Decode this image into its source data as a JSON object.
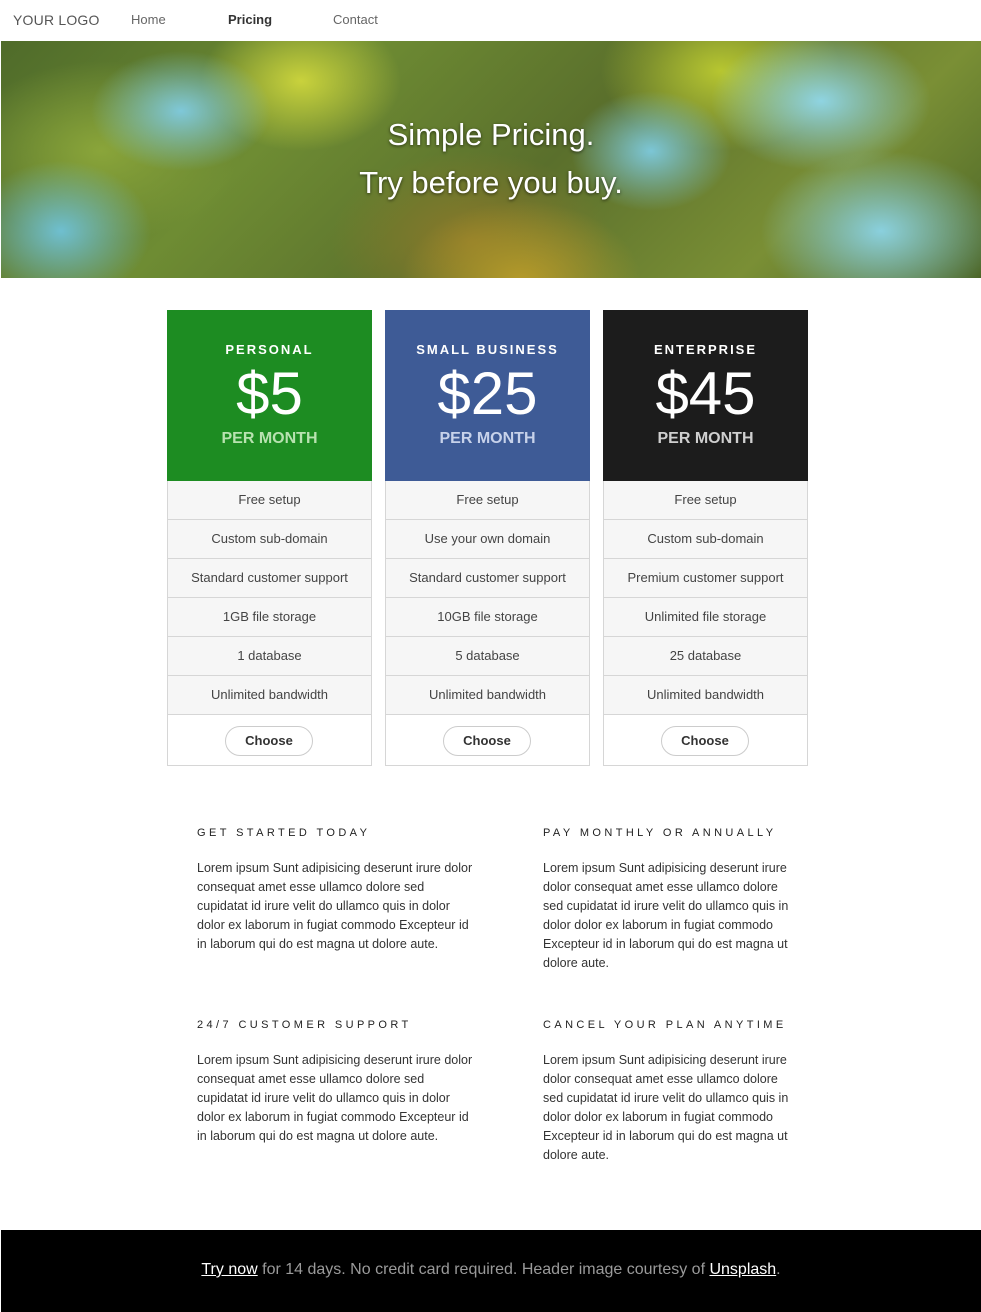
{
  "nav": {
    "logo": "YOUR LOGO",
    "items": [
      {
        "label": "Home",
        "active": false
      },
      {
        "label": "Pricing",
        "active": true
      },
      {
        "label": "Contact",
        "active": false
      }
    ]
  },
  "hero": {
    "line1": "Simple Pricing.",
    "line2": "Try before you buy."
  },
  "plans": [
    {
      "name": "PERSONAL",
      "price": "$5",
      "period": "PER MONTH",
      "color": "#1d8c22",
      "features": [
        "Free setup",
        "Custom sub-domain",
        "Standard customer support",
        "1GB file storage",
        "1 database",
        "Unlimited bandwidth"
      ],
      "button": "Choose"
    },
    {
      "name": "SMALL BUSINESS",
      "price": "$25",
      "period": "PER MONTH",
      "color": "#3e5b96",
      "features": [
        "Free setup",
        "Use your own domain",
        "Standard customer support",
        "10GB file storage",
        "5 database",
        "Unlimited bandwidth"
      ],
      "button": "Choose"
    },
    {
      "name": "ENTERPRISE",
      "price": "$45",
      "period": "PER MONTH",
      "color": "#1c1c1c",
      "features": [
        "Free setup",
        "Custom sub-domain",
        "Premium customer support",
        "Unlimited file storage",
        "25 database",
        "Unlimited bandwidth"
      ],
      "button": "Choose"
    }
  ],
  "features": [
    {
      "title": "GET STARTED TODAY",
      "text": "Lorem ipsum Sunt adipisicing deserunt irure dolor consequat amet esse ullamco dolore sed cupidatat id irure velit do ullamco quis in dolor dolor ex laborum in fugiat commodo Excepteur id in laborum qui do est magna ut dolore aute."
    },
    {
      "title": "PAY MONTHLY OR ANNUALLY",
      "text": "Lorem ipsum Sunt adipisicing deserunt irure dolor consequat amet esse ullamco dolore sed cupidatat id irure velit do ullamco quis in dolor dolor ex laborum in fugiat commodo Excepteur id in laborum qui do est magna ut dolore aute."
    },
    {
      "title": "24/7 CUSTOMER SUPPORT",
      "text": "Lorem ipsum Sunt adipisicing deserunt irure dolor consequat amet esse ullamco dolore sed cupidatat id irure velit do ullamco quis in dolor dolor ex laborum in fugiat commodo Excepteur id in laborum qui do est magna ut dolore aute."
    },
    {
      "title": "CANCEL YOUR PLAN ANYTIME",
      "text": "Lorem ipsum Sunt adipisicing deserunt irure dolor consequat amet esse ullamco dolore sed cupidatat id irure velit do ullamco quis in dolor dolor ex laborum in fugiat commodo Excepteur id in laborum qui do est magna ut dolore aute."
    }
  ],
  "footer": {
    "try_link": "Try now",
    "middle": " for 14 days. No credit card required. Header image courtesy of ",
    "unsplash_link": "Unsplash",
    "end": "."
  }
}
